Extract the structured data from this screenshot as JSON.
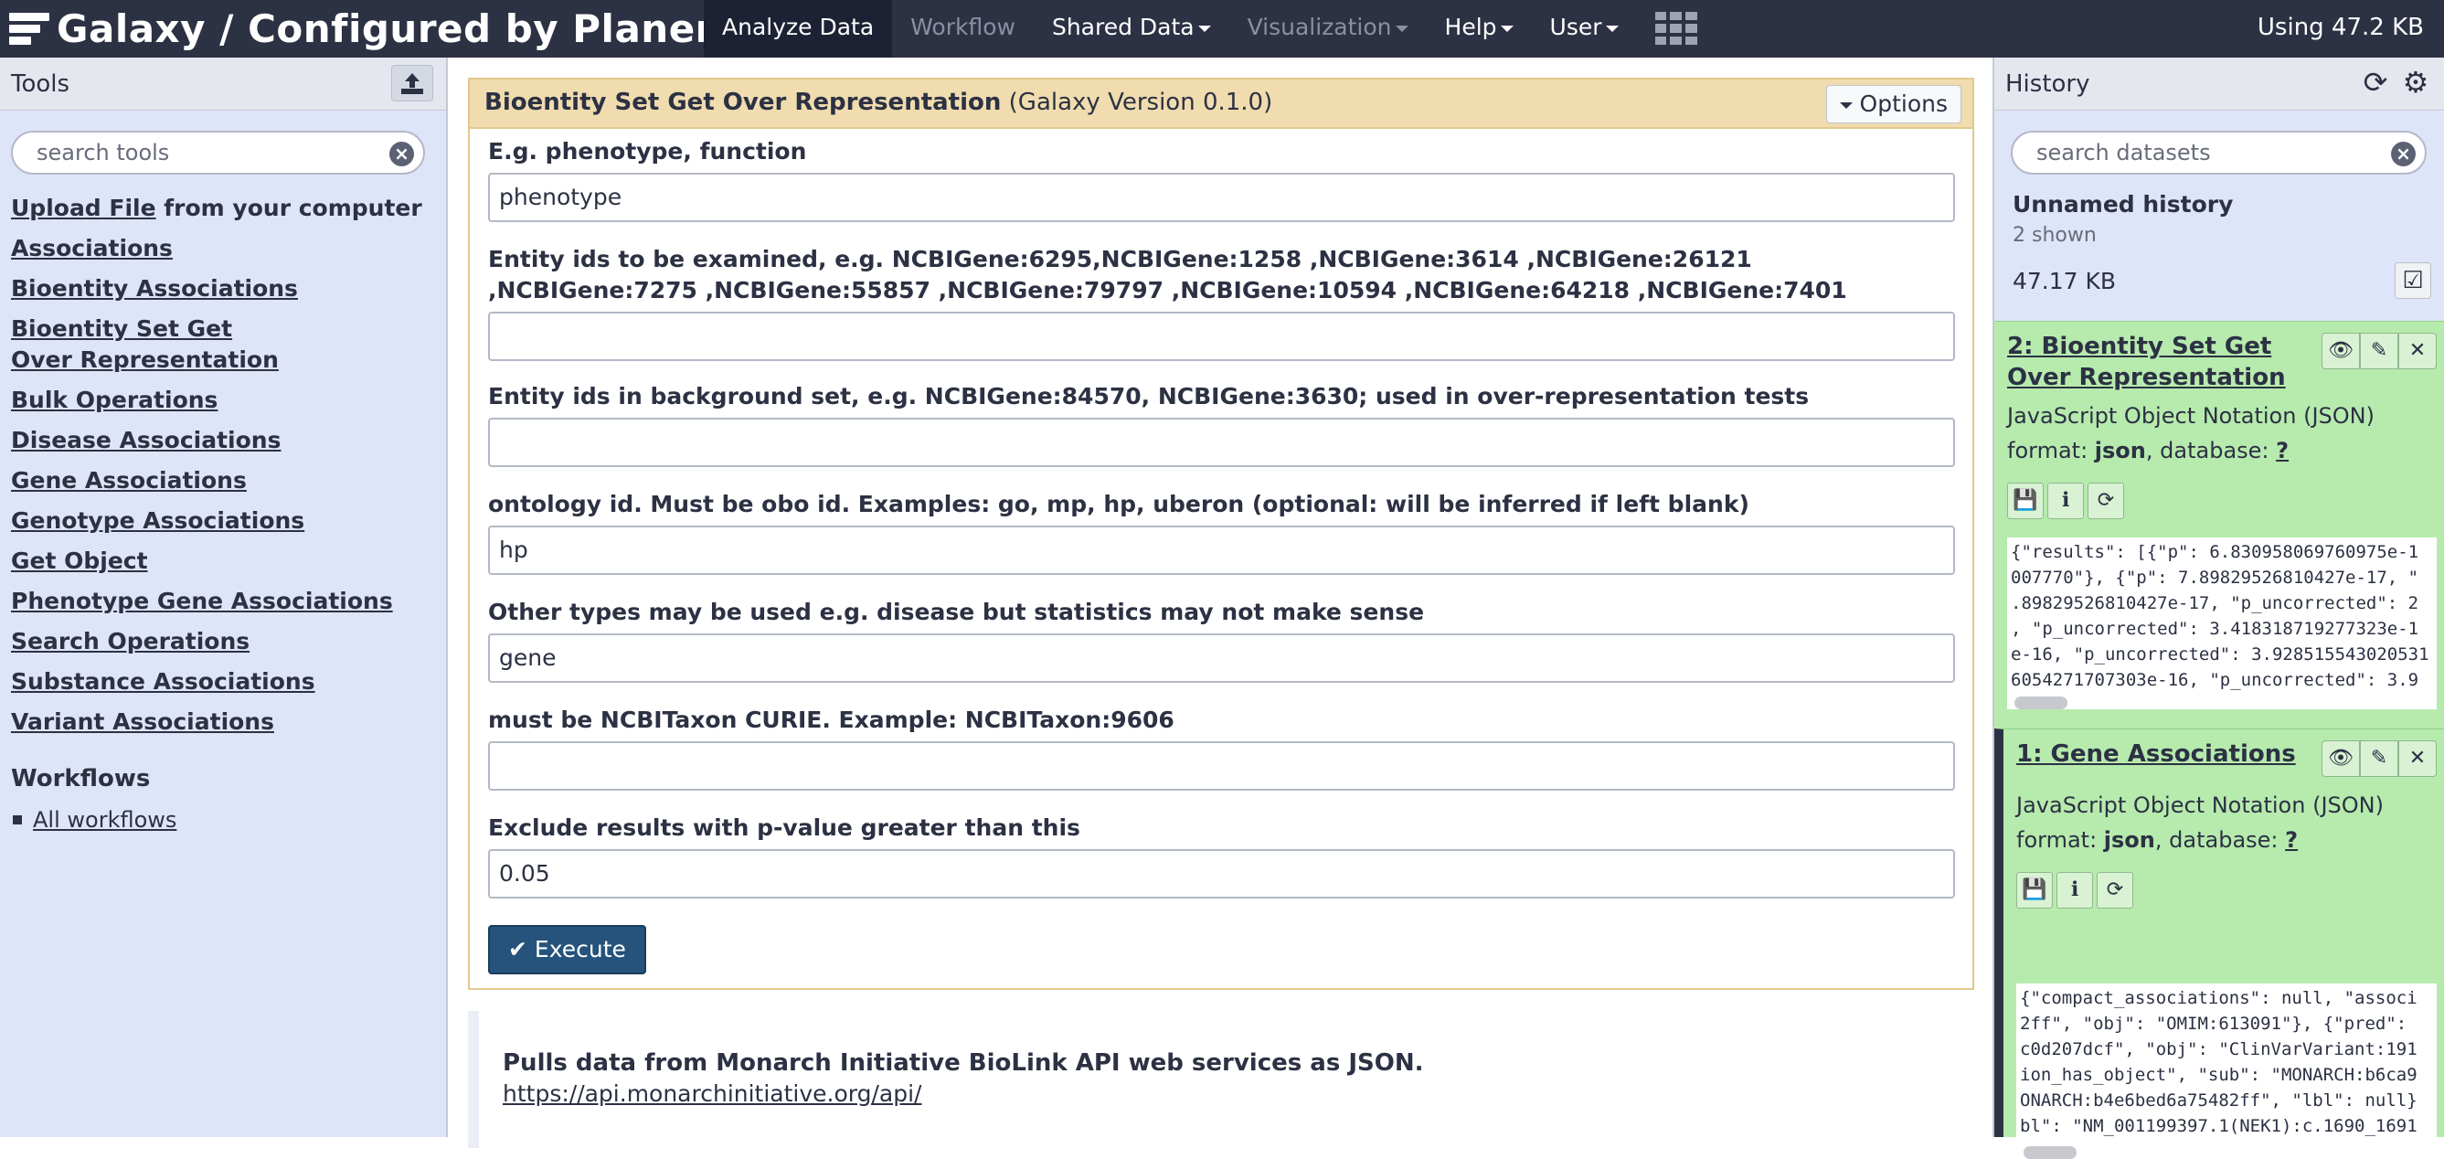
{
  "masthead": {
    "brand": "Galaxy / Configured by Planemo",
    "nav": [
      {
        "label": "Analyze Data",
        "state": "active",
        "dropdown": false
      },
      {
        "label": "Workflow",
        "state": "disabled",
        "dropdown": false
      },
      {
        "label": "Shared Data",
        "state": "normal",
        "dropdown": true
      },
      {
        "label": "Visualization",
        "state": "disabled",
        "dropdown": true
      },
      {
        "label": "Help",
        "state": "normal",
        "dropdown": true
      },
      {
        "label": "User",
        "state": "normal",
        "dropdown": true
      }
    ],
    "quota": "Using 47.2 KB"
  },
  "tools": {
    "title": "Tools",
    "search_placeholder": "search tools",
    "upload": {
      "link": "Upload File",
      "rest": " from your computer"
    },
    "items": [
      "Associations",
      "Bioentity Associations",
      "Bioentity Set Get Over Representation",
      "Bulk Operations",
      "Disease Associations",
      "Gene Associations",
      "Genotype Associations",
      "Get Object",
      "Phenotype Gene Associations",
      "Search Operations",
      "Substance Associations",
      "Variant Associations"
    ],
    "workflows_title": "Workflows",
    "workflows_link": "All workflows"
  },
  "form": {
    "tool_name": "Bioentity Set Get Over Representation",
    "version": " (Galaxy Version 0.1.0)",
    "options_label": "Options",
    "fields": [
      {
        "label": "E.g. phenotype, function",
        "value": "phenotype"
      },
      {
        "label": "Entity ids to be examined, e.g. NCBIGene:6295,NCBIGene:1258 ,NCBIGene:3614 ,NCBIGene:26121 ,NCBIGene:7275 ,NCBIGene:55857 ,NCBIGene:79797 ,NCBIGene:10594 ,NCBIGene:64218 ,NCBIGene:7401",
        "value": ""
      },
      {
        "label": "Entity ids in background set, e.g. NCBIGene:84570, NCBIGene:3630; used in over-representation tests",
        "value": ""
      },
      {
        "label": "ontology id. Must be obo id. Examples: go, mp, hp, uberon (optional: will be inferred if left blank)",
        "value": "hp"
      },
      {
        "label": "Other types may be used e.g. disease but statistics may not make sense",
        "value": "gene"
      },
      {
        "label": "must be NCBITaxon CURIE. Example: NCBITaxon:9606",
        "value": ""
      },
      {
        "label": "Exclude results with p-value greater than this",
        "value": "0.05"
      }
    ],
    "execute_label": "Execute"
  },
  "help": {
    "text": "Pulls data from Monarch Initiative BioLink API web services as JSON.",
    "link": "https://api.monarchinitiative.org/api/"
  },
  "history": {
    "title": "History",
    "search_placeholder": "search datasets",
    "name": "Unnamed history",
    "shown": "2 shown",
    "size": "47.17 KB",
    "datasets": [
      {
        "title": "2: Bioentity Set Get Over Representation",
        "format_desc": "JavaScript Object Notation (JSON)",
        "format_label": "format: ",
        "format": "json",
        "db_label": ", database: ",
        "db": "?",
        "peek": "{\"results\": [{\"p\": 6.830958069760975e-1\n007770\"}, {\"p\": 7.89829526810427e-17, \"\n.89829526810427e-17, \"p_uncorrected\": 2\n, \"p_uncorrected\": 3.418318719277323e-1\ne-16, \"p_uncorrected\": 3.928515543020531\n6054271707303e-16, \"p_uncorrected\": 3.9"
      },
      {
        "title": "1: Gene Associations",
        "format_desc": "JavaScript Object Notation (JSON)",
        "format_label": "format: ",
        "format": "json",
        "db_label": ", database: ",
        "db": "?",
        "peek": "{\"compact_associations\": null, \"associ\n2ff\", \"obj\": \"OMIM:613091\"}, {\"pred\":\nc0d207dcf\", \"obj\": \"ClinVarVariant:191\nion_has_object\", \"sub\": \"MONARCH:b6ca9\nONARCH:b4e6bed6a75482ff\", \"lbl\": null}\nbl\": \"NM_001199397.1(NEK1):c.1690_1691"
      }
    ]
  },
  "colors": {
    "masthead": "#2c3143",
    "panel_bg": "#dfe5f9",
    "form_border": "#e5c88f",
    "form_header": "#f0dcae",
    "dataset_ok": "#b7ebae",
    "execute": "#25537b"
  }
}
